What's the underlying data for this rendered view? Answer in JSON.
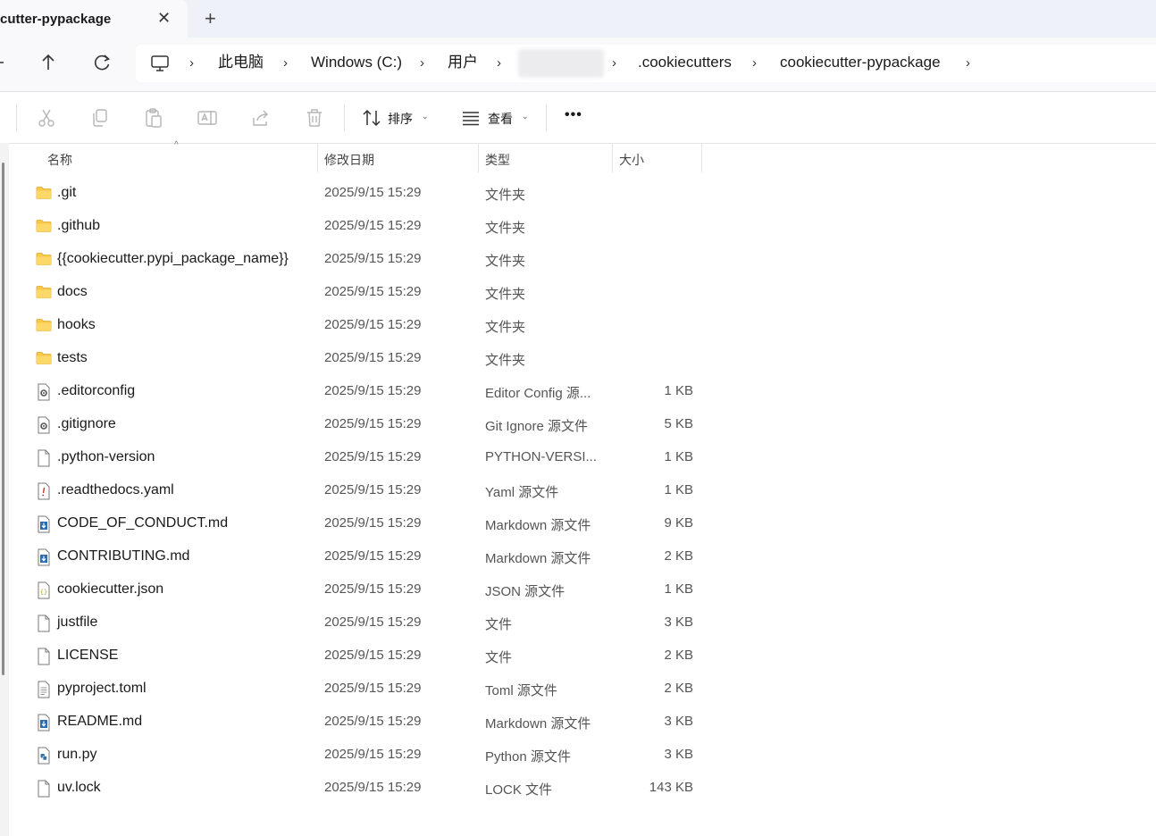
{
  "window": {
    "tab_title": "cutter-pypackage",
    "close_glyph": "✕",
    "new_tab_glyph": "+"
  },
  "nav": {
    "back_icon": "arrow-left",
    "up_icon": "arrow-up",
    "refresh_icon": "refresh",
    "computer_icon": "monitor",
    "breadcrumb": [
      "此电脑",
      "Windows (C:)",
      "用户",
      "",
      ".cookiecutters",
      "cookiecutter-pypackage"
    ],
    "separator": "›"
  },
  "commandbar": {
    "sort_label": "排序",
    "view_label": "查看",
    "more_label": "•••"
  },
  "columns": {
    "name": "名称",
    "modified": "修改日期",
    "type": "类型",
    "size": "大小"
  },
  "files": [
    {
      "name": ".git",
      "modified": "2025/9/15 15:29",
      "type": "文件夹",
      "size": "",
      "icon": "folder-icon"
    },
    {
      "name": ".github",
      "modified": "2025/9/15 15:29",
      "type": "文件夹",
      "size": "",
      "icon": "folder-icon"
    },
    {
      "name": "{{cookiecutter.pypi_package_name}}",
      "modified": "2025/9/15 15:29",
      "type": "文件夹",
      "size": "",
      "icon": "folder-icon"
    },
    {
      "name": "docs",
      "modified": "2025/9/15 15:29",
      "type": "文件夹",
      "size": "",
      "icon": "folder-icon"
    },
    {
      "name": "hooks",
      "modified": "2025/9/15 15:29",
      "type": "文件夹",
      "size": "",
      "icon": "folder-icon"
    },
    {
      "name": "tests",
      "modified": "2025/9/15 15:29",
      "type": "文件夹",
      "size": "",
      "icon": "folder-icon"
    },
    {
      "name": ".editorconfig",
      "modified": "2025/9/15 15:29",
      "type": "Editor Config 源...",
      "size": "1 KB",
      "icon": "config-file-icon"
    },
    {
      "name": ".gitignore",
      "modified": "2025/9/15 15:29",
      "type": "Git Ignore 源文件",
      "size": "5 KB",
      "icon": "config-file-icon"
    },
    {
      "name": ".python-version",
      "modified": "2025/9/15 15:29",
      "type": "PYTHON-VERSI...",
      "size": "1 KB",
      "icon": "blank-file-icon"
    },
    {
      "name": ".readthedocs.yaml",
      "modified": "2025/9/15 15:29",
      "type": "Yaml 源文件",
      "size": "1 KB",
      "icon": "yaml-file-icon"
    },
    {
      "name": "CODE_OF_CONDUCT.md",
      "modified": "2025/9/15 15:29",
      "type": "Markdown 源文件",
      "size": "9 KB",
      "icon": "markdown-file-icon"
    },
    {
      "name": "CONTRIBUTING.md",
      "modified": "2025/9/15 15:29",
      "type": "Markdown 源文件",
      "size": "2 KB",
      "icon": "markdown-file-icon"
    },
    {
      "name": "cookiecutter.json",
      "modified": "2025/9/15 15:29",
      "type": "JSON 源文件",
      "size": "1 KB",
      "icon": "json-file-icon"
    },
    {
      "name": "justfile",
      "modified": "2025/9/15 15:29",
      "type": "文件",
      "size": "3 KB",
      "icon": "blank-file-icon"
    },
    {
      "name": "LICENSE",
      "modified": "2025/9/15 15:29",
      "type": "文件",
      "size": "2 KB",
      "icon": "blank-file-icon"
    },
    {
      "name": "pyproject.toml",
      "modified": "2025/9/15 15:29",
      "type": "Toml 源文件",
      "size": "2 KB",
      "icon": "text-file-icon"
    },
    {
      "name": "README.md",
      "modified": "2025/9/15 15:29",
      "type": "Markdown 源文件",
      "size": "3 KB",
      "icon": "markdown-file-icon"
    },
    {
      "name": "run.py",
      "modified": "2025/9/15 15:29",
      "type": "Python 源文件",
      "size": "3 KB",
      "icon": "python-file-icon"
    },
    {
      "name": "uv.lock",
      "modified": "2025/9/15 15:29",
      "type": "LOCK 文件",
      "size": "143 KB",
      "icon": "blank-file-icon"
    }
  ]
}
